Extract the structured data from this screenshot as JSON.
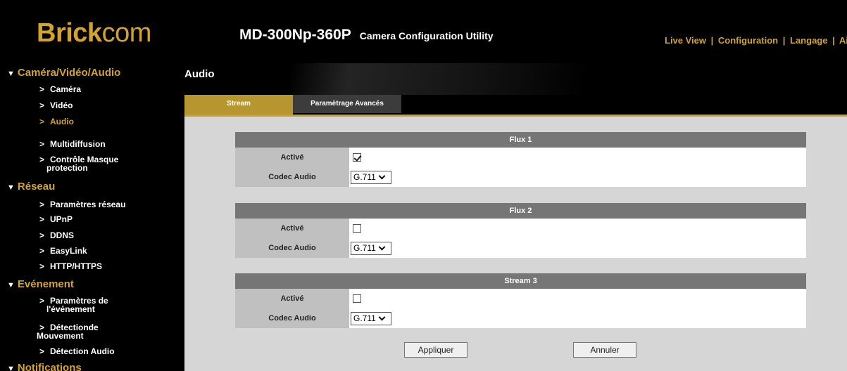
{
  "brand": {
    "logo_bold": "Brick",
    "logo_light": "com",
    "color": "#d4a42a"
  },
  "header": {
    "model": "MD-300Np-360P",
    "utility": "Camera Configuration Utility",
    "nav": [
      "Live View",
      "Configuration",
      "Langage",
      "Aide"
    ],
    "separator": "|"
  },
  "sidebar": {
    "sections": [
      {
        "label": "Caméra/Vidéo/Audio",
        "marker": "▼"
      },
      {
        "label": "Réseau",
        "marker": "▼"
      },
      {
        "label": "Evénement",
        "marker": "▼"
      },
      {
        "label": "Notifications",
        "marker": "▼"
      }
    ],
    "bullet": ">",
    "items": [
      {
        "label": "Caméra"
      },
      {
        "label": "Vidéo"
      },
      {
        "label": "Audio",
        "active": true
      },
      {
        "label": "Multidiffusion"
      },
      {
        "label": "Contrôle Masque",
        "line2": "protection"
      },
      {
        "label": "Paramètres réseau"
      },
      {
        "label": "UPnP"
      },
      {
        "label": "DDNS"
      },
      {
        "label": "EasyLink"
      },
      {
        "label": "HTTP/HTTPS"
      },
      {
        "label": "Paramètres de",
        "line2": "l'événement"
      },
      {
        "label": "Détectionde",
        "line2": "Mouvement"
      },
      {
        "label": "Détection Audio"
      }
    ]
  },
  "page": {
    "title": "Audio"
  },
  "tabs": [
    {
      "label": "Stream",
      "active": true
    },
    {
      "label": "Paramètrage Avancés",
      "active": false
    }
  ],
  "panels": [
    {
      "title": "Flux 1",
      "enabled_label": "Activé",
      "enabled": true,
      "codec_label": "Codec Audio",
      "codec": "G.711"
    },
    {
      "title": "Flux 2",
      "enabled_label": "Activé",
      "enabled": false,
      "codec_label": "Codec Audio",
      "codec": "G.711"
    },
    {
      "title": "Stream 3",
      "enabled_label": "Activé",
      "enabled": false,
      "codec_label": "Codec Audio",
      "codec": "G.711"
    }
  ],
  "buttons": {
    "apply": "Appliquer",
    "cancel": "Annuler"
  }
}
